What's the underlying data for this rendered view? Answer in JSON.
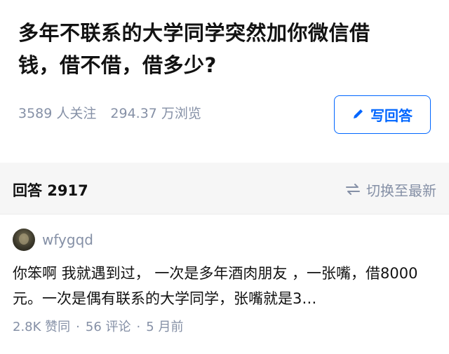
{
  "question": {
    "title": "多年不联系的大学同学突然加你微信借钱，借不借，借多少?",
    "followers": "3589 人关注",
    "views": "294.37 万浏览",
    "write_answer_label": "写回答"
  },
  "answers_header": {
    "count_label": "回答 2917",
    "sort_label": "切换至最新"
  },
  "answer": {
    "author": "wfygqd",
    "excerpt": "你笨啊 我就遇到过， 一次是多年酒肉朋友 ，一张嘴，借8000元。一次是偶有联系的大学同学，张嘴就是3…",
    "likes": "2.8K 赞同",
    "comments": "56 评论",
    "time": "5 月前",
    "separator": "·"
  },
  "icons": {
    "write": "pencil-icon",
    "sort": "swap-arrows-icon"
  },
  "colors": {
    "accent": "#0066ff",
    "muted": "#8590a6",
    "text": "#121212",
    "section_bg": "#f6f6f6"
  }
}
